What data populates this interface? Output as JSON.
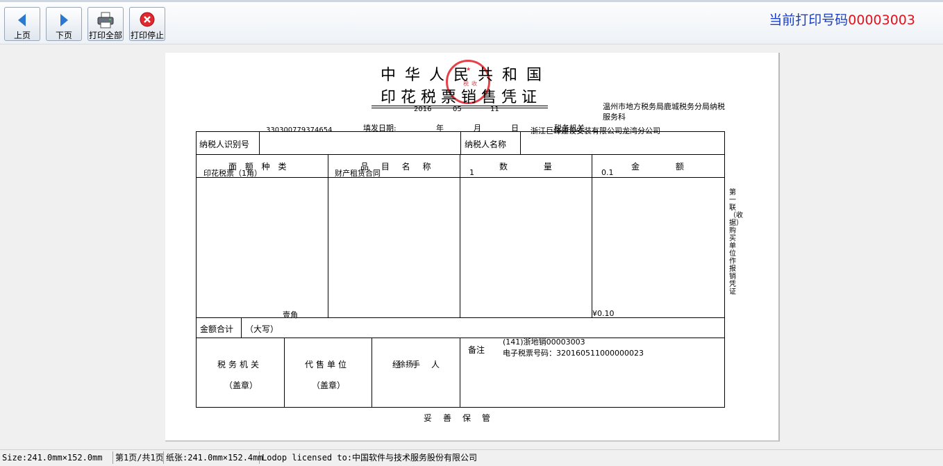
{
  "toolbar": {
    "prev_label": "上页",
    "next_label": "下页",
    "print_all_label": "打印全部",
    "print_stop_label": "打印停止",
    "print_no_label": "当前打印号码",
    "print_no_value": "00003003",
    "colors": {
      "label": "#1c3fc0",
      "value": "#e8101a"
    }
  },
  "voucher": {
    "title_line1": "中华人民共和国",
    "title_line2": "印花税票销售凭证",
    "seal_icon": "official-seal",
    "date": {
      "year": "2016",
      "month": "05",
      "day": "11"
    },
    "issue_date_label": "填发日期:",
    "year_label": "年",
    "month_label": "月",
    "day_label": "日",
    "tax_org_label": "税务机关",
    "tax_org_name": "温州市地方税务局鹿城税务分局纳税服务科",
    "taxpayer_id_value": "330300779374654",
    "taxpayer_id_label": "纳税人识别号",
    "taxpayer_name_label": "纳税人名称",
    "taxpayer_name_value": "浙江巨峰建设安装有限公司龙湾分公司",
    "columns": {
      "denomination": "面 额 种 类",
      "item": "品 目 名 称",
      "quantity": "数 量",
      "amount": "金 额"
    },
    "row": {
      "denomination": "印花税票（1角）",
      "item": "财产租赁合同",
      "quantity": "1",
      "amount": "0.1"
    },
    "total_label": "金额合计",
    "total_upper_label": "（大写）",
    "total_upper_value": "壹角",
    "total_value": "¥0.10",
    "tax_office_label": "税务机关",
    "agent_label": "代售单位",
    "seal_label": "（盖章）",
    "handler_label": "经手人",
    "handler_value": "徐扬",
    "remarks_label": "备注",
    "remarks_line1": "(141)浙地销00003003",
    "remarks_line2": "电子税票号码：320160511000000023",
    "side_note": "第一联（收据）购买单位作报销凭证",
    "footer": "妥善保管"
  },
  "statusbar": {
    "size": "Size:241.0mm×152.0mm",
    "page": "第1页/共1页",
    "paper": "纸张:241.0mm×152.4mm",
    "license": "Lodop licensed to:中国软件与技术服务股份有限公司"
  }
}
